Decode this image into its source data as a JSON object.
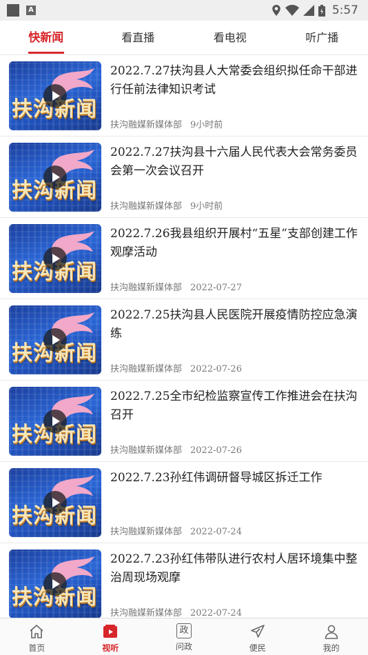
{
  "status_bar": {
    "time": "5:57",
    "app_letter": "A"
  },
  "tabs": [
    {
      "label": "快新闻",
      "active": true
    },
    {
      "label": "看直播",
      "active": false
    },
    {
      "label": "看电视",
      "active": false
    },
    {
      "label": "听广播",
      "active": false
    }
  ],
  "thumbnail": {
    "overlay_text": "扶沟新闻"
  },
  "news": [
    {
      "title": "2022.7.27扶沟县人大常委会组织拟任命干部进行任前法律知识考试",
      "source": "扶沟融媒新媒体部",
      "time": "9小时前"
    },
    {
      "title": "2022.7.27扶沟县十六届人民代表大会常务委员会第一次会议召开",
      "source": "扶沟融媒新媒体部",
      "time": "9小时前"
    },
    {
      "title": "2022.7.26我县组织开展村“五星”支部创建工作观摩活动",
      "source": "扶沟融媒新媒体部",
      "time": "2022-07-27"
    },
    {
      "title": "2022.7.25扶沟县人民医院开展疫情防控应急演练",
      "source": "扶沟融媒新媒体部",
      "time": "2022-07-26"
    },
    {
      "title": "2022.7.25全市纪检监察宣传工作推进会在扶沟召开",
      "source": "扶沟融媒新媒体部",
      "time": "2022-07-26"
    },
    {
      "title": "2022.7.23孙红伟调研督导城区拆迁工作",
      "source": "扶沟融媒新媒体部",
      "time": "2022-07-24"
    },
    {
      "title": "2022.7.23孙红伟带队进行农村人居环境集中整治周现场观摩",
      "source": "扶沟融媒新媒体部",
      "time": "2022-07-24"
    }
  ],
  "bottom_nav": [
    {
      "label": "首页",
      "icon": "home-icon",
      "active": false
    },
    {
      "label": "视听",
      "icon": "video-icon",
      "active": true
    },
    {
      "label": "问政",
      "icon": "gov-icon",
      "glyph": "政",
      "active": false
    },
    {
      "label": "便民",
      "icon": "send-icon",
      "active": false
    },
    {
      "label": "我的",
      "icon": "user-icon",
      "active": false
    }
  ],
  "colors": {
    "accent": "#d7262b",
    "thumb_blue": "#2a66d6"
  }
}
